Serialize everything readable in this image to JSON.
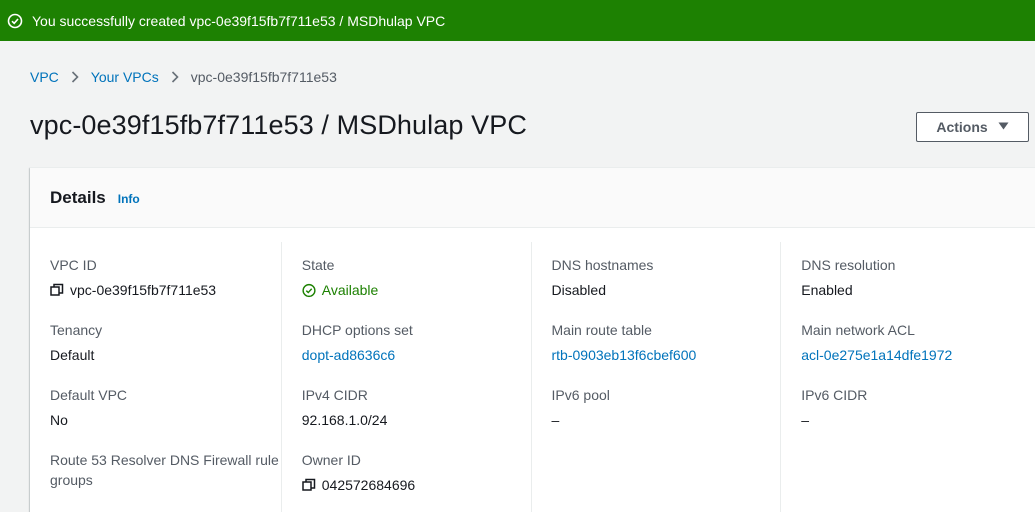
{
  "flash": {
    "message": "You successfully created vpc-0e39f15fb7f711e53 / MSDhulap VPC"
  },
  "breadcrumb": {
    "items": [
      "VPC",
      "Your VPCs",
      "vpc-0e39f15fb7f711e53"
    ]
  },
  "page": {
    "title": "vpc-0e39f15fb7f711e53 / MSDhulap VPC",
    "actions_label": "Actions"
  },
  "details": {
    "heading": "Details",
    "info_label": "Info",
    "columns": [
      [
        {
          "label": "VPC ID",
          "value": "vpc-0e39f15fb7f711e53"
        },
        {
          "label": "Tenancy",
          "value": "Default"
        },
        {
          "label": "Default VPC",
          "value": "No"
        },
        {
          "label": "Route 53 Resolver DNS Firewall rule groups",
          "value": ""
        }
      ],
      [
        {
          "label": "State",
          "value": "Available"
        },
        {
          "label": "DHCP options set",
          "value": "dopt-ad8636c6"
        },
        {
          "label": "IPv4 CIDR",
          "value": "92.168.1.0/24"
        },
        {
          "label": "Owner ID",
          "value": "042572684696"
        }
      ],
      [
        {
          "label": "DNS hostnames",
          "value": "Disabled"
        },
        {
          "label": "Main route table",
          "value": "rtb-0903eb13f6cbef600"
        },
        {
          "label": "IPv6 pool",
          "value": "–"
        }
      ],
      [
        {
          "label": "DNS resolution",
          "value": "Enabled"
        },
        {
          "label": "Main network ACL",
          "value": "acl-0e275e1a14dfe1972"
        },
        {
          "label": "IPv6 CIDR",
          "value": "–"
        }
      ]
    ]
  },
  "colors": {
    "success_green": "#1d8102",
    "link_blue": "#0073bb"
  }
}
